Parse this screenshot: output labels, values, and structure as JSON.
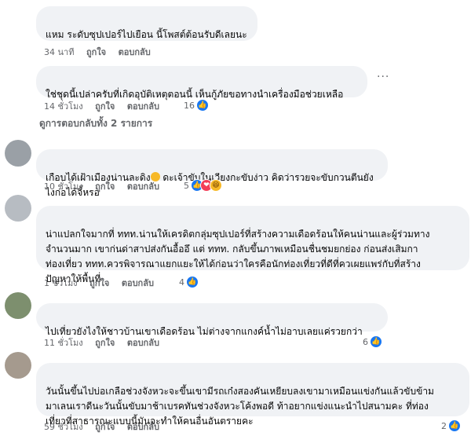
{
  "comments": [
    {
      "text": "แหม ระดับซุปเปอร์ไปเยือน นี้โพสต์ต้อนรับดีเลยนะ",
      "time": "34 นาที",
      "like_label": "ถูกใจ",
      "reply_label": "ตอบกลับ",
      "reaction_count": ""
    },
    {
      "text": "ใช่ชุดนี้เปล่าครับที่เกิดอุบัติเหตุตอนนี้ เห็นกู้ภัยขอทางนำเครื่องมือช่วยเหลือ",
      "time": "14 ชั่วโมง",
      "like_label": "ถูกใจ",
      "reply_label": "ตอบกลับ",
      "reaction_count": "16",
      "more_label": "···",
      "view_replies_label": "ดูการตอบกลับทั้ง 2 รายการ"
    },
    {
      "text": "เกือบได้เฝ้าเมืองน่านละดิง",
      "text_tail": " ดะเจ้าขับในเวียงกะขับง่าว คิดว่ารวยจะขับกวนตีนยังไงก่อได้จี้หรอ",
      "time": "10 ชั่วโมง",
      "like_label": "ถูกใจ",
      "reply_label": "ตอบกลับ",
      "reaction_count": "5"
    },
    {
      "text": "น่าแปลกใจมากที่ ททท.น่านให้เครดิตกลุ่มซุปเปอร์ที่สร้างความเดือดร้อนให้คนน่านและผู้ร่วมทาง\nจำนวนมาก เขาก่นด่าสาปส่งกันอื้ออึ แต่ ททท. กลับขึ้นภาพเหมือนชื่นชมยกย่อง ก่อนส่งเสิมกา\nท่องเที่ยว ททท.ควรพิจารณาแยกแยะให้ได้ก่อนว่าใครคือนักท่องเที่ยวที่ดีที่ควเผยแพร่กับที่สร้าง\nปัญหาให้พื้นที่",
      "time": "1 ชั่วโมง",
      "like_label": "ถูกใจ",
      "reply_label": "ตอบกลับ",
      "reaction_count": "4"
    },
    {
      "text": "ไปเที่ยวยังไงให้ชาวบ้านเขาเดือดร้อน ไม่ต่างจากแกงค์น้ำไม่อาบเลยแค่รวยกว่า",
      "time": "11 ชั่วโมง",
      "like_label": "ถูกใจ",
      "reply_label": "ตอบกลับ",
      "reaction_count": "6"
    },
    {
      "text": "วันนั้นขึ้นไปบ่อเกลือช่วงจังหวะจะขึ้นเขามีรถเก๋งสองคันเหยียบลงเขามาเหมือนแข่งกันแล้วขับข้าม\nมาเลนเราดีนะวันนั้นขับมาช้าเบรคทันช่วงจังหวะโค้งพอดี ท้าอยากแข่งแนะนำไปสนามคะ ที่ท่อง\nเที่ยวที่สาธารณะแบบนี้มันจะทำให้คนอื่นอันตรายคะ",
      "time": "59 ชั่วโมง",
      "like_label": "ถูกใจ",
      "reply_label": "ตอบกลับ",
      "reaction_count": "2"
    }
  ],
  "colors": {
    "bubble_bg": "#f0f2f5",
    "meta_text": "#65676b",
    "like_blue": "#1877f2",
    "love_red": "#f33e58",
    "haha_yellow": "#f7b928"
  }
}
